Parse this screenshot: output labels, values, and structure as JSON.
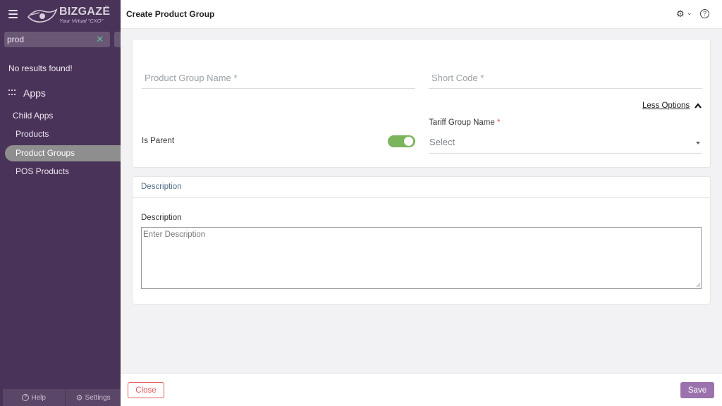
{
  "app": {
    "brand": "BIZGAZE",
    "brand_tm": "™",
    "tagline": "Your Virtual \"CXO\""
  },
  "sidebar": {
    "search_value": "prod",
    "no_results": "No results found!",
    "apps_label": "Apps",
    "items": [
      {
        "label": "Child Apps",
        "active": false
      },
      {
        "label": "Products",
        "active": false
      },
      {
        "label": "Product Groups",
        "active": true
      },
      {
        "label": "POS Products",
        "active": false
      }
    ],
    "bottom": {
      "help": "Help",
      "settings": "Settings"
    }
  },
  "header": {
    "title": "Create Product Group"
  },
  "form": {
    "product_group_name_placeholder": "Product Group Name *",
    "short_code_placeholder": "Short Code *",
    "less_options": "Less Options",
    "tariff_label": "Tariff Group Name",
    "required_mark": "*",
    "tariff_select_value": "Select",
    "is_parent_label": "Is Parent",
    "is_parent_value": true
  },
  "description_section": {
    "title": "Description",
    "label": "Description",
    "placeholder": "Enter Description"
  },
  "footer": {
    "close_label": "Close",
    "save_label": "Save"
  },
  "colors": {
    "sidebar_bg": "#4a3358",
    "active_item_bg": "#8e8e8e",
    "toggle_on": "#7ab55c",
    "save_button": "#9b72ad",
    "close_button": "#e05c5c",
    "search_clear": "#5fbf9a"
  }
}
